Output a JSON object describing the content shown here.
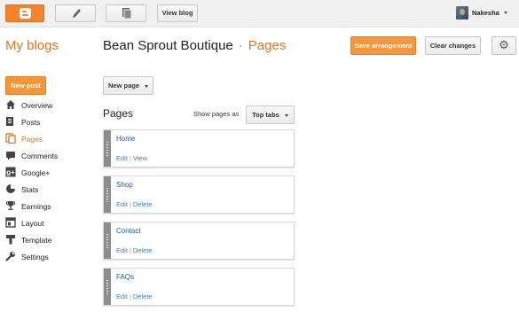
{
  "topbar": {
    "view_blog_label": "View blog",
    "user_name": "Nakesha"
  },
  "header": {
    "my_blogs": "My blogs",
    "blog_title": "Bean Sprout Boutique",
    "separator": "·",
    "section": "Pages",
    "save_label": "Save arrangement",
    "clear_label": "Clear changes"
  },
  "sidebar": {
    "new_post_label": "New post",
    "items": [
      {
        "label": "Overview",
        "icon": "home-icon"
      },
      {
        "label": "Posts",
        "icon": "posts-icon"
      },
      {
        "label": "Pages",
        "icon": "pages-icon"
      },
      {
        "label": "Comments",
        "icon": "comments-icon"
      },
      {
        "label": "Google+",
        "icon": "google-plus-icon"
      },
      {
        "label": "Stats",
        "icon": "stats-icon"
      },
      {
        "label": "Earnings",
        "icon": "trophy-icon"
      },
      {
        "label": "Layout",
        "icon": "layout-icon"
      },
      {
        "label": "Template",
        "icon": "template-icon"
      },
      {
        "label": "Settings",
        "icon": "wrench-icon"
      }
    ],
    "active": "Pages"
  },
  "main": {
    "new_page_label": "New page",
    "section_title": "Pages",
    "show_pages_as": "Show pages as",
    "tabs_select": "Top tabs",
    "pages": [
      {
        "title": "Home",
        "action1": "Edit",
        "action2": "View"
      },
      {
        "title": "Shop",
        "action1": "Edit",
        "action2": "Delete"
      },
      {
        "title": "Contact",
        "action1": "Edit",
        "action2": "Delete"
      },
      {
        "title": "FAQs",
        "action1": "Edit",
        "action2": "Delete"
      }
    ]
  },
  "colors": {
    "accent": "#e8731b",
    "button_orange": "#f7963a",
    "link_blue": "#1c58a8"
  }
}
